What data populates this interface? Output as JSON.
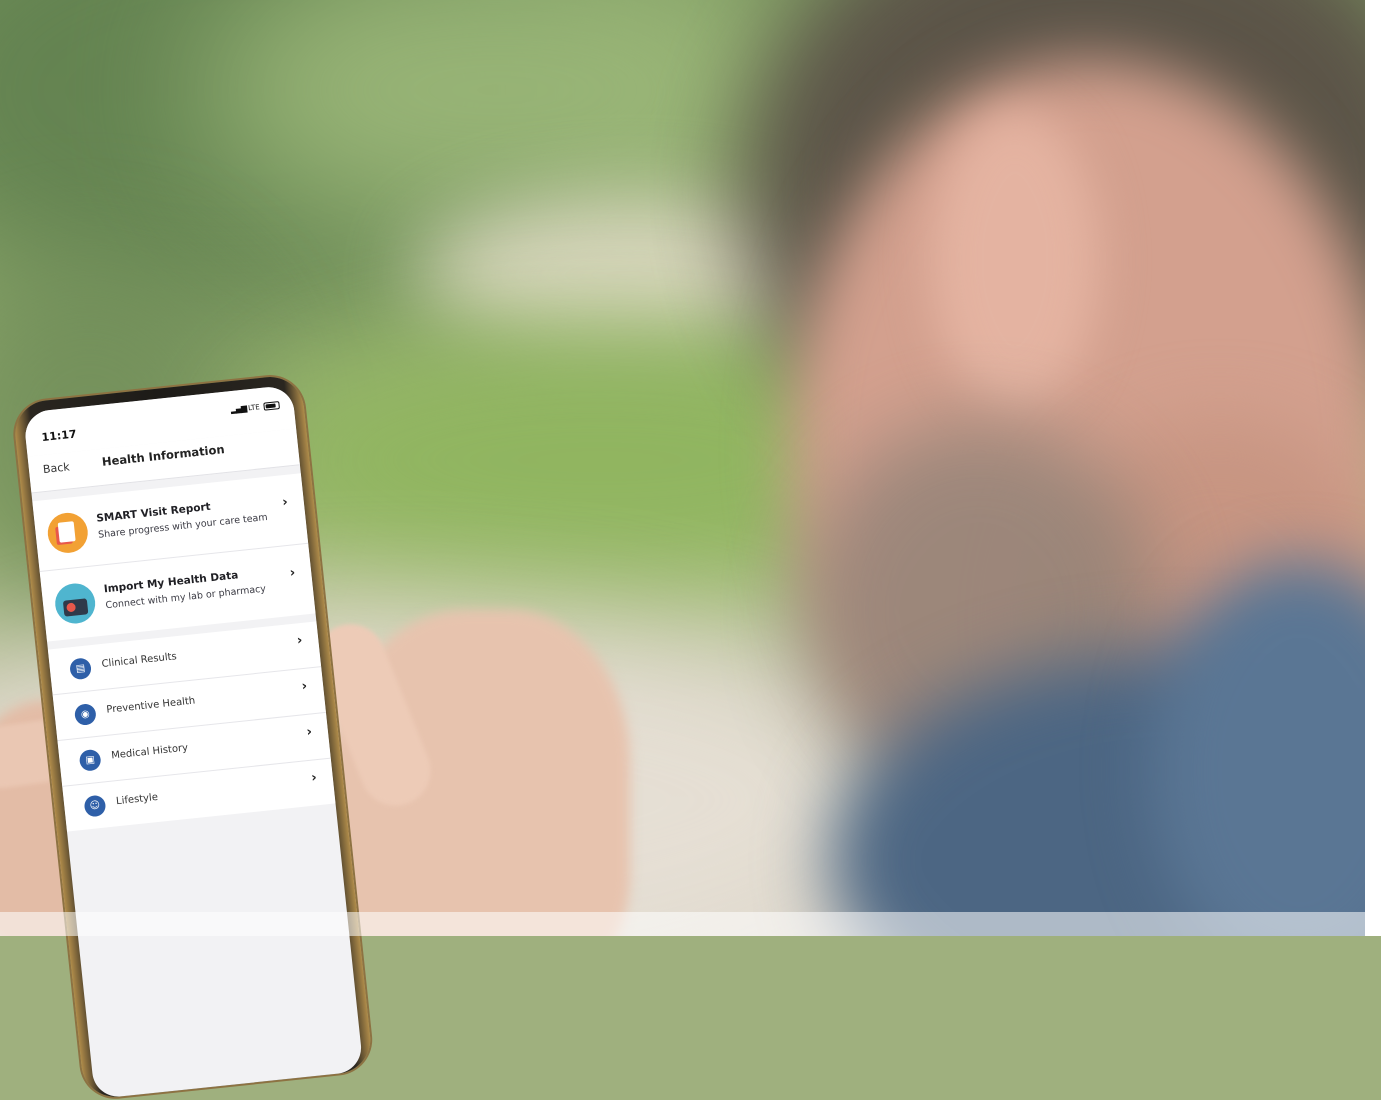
{
  "status_bar": {
    "time": "11:17",
    "network": "LTE"
  },
  "nav": {
    "back_label": "Back",
    "title": "Health Information"
  },
  "featured_items": [
    {
      "title": "SMART Visit Report",
      "subtitle": "Share progress with your care team",
      "icon": "report-icon"
    },
    {
      "title": "Import My Health Data",
      "subtitle": "Connect with my lab or pharmacy",
      "icon": "import-data-icon"
    }
  ],
  "menu_items": [
    {
      "label": "Clinical Results",
      "icon": "clipboard-icon"
    },
    {
      "label": "Preventive Health",
      "icon": "eye-icon"
    },
    {
      "label": "Medical History",
      "icon": "history-icon"
    },
    {
      "label": "Lifestyle",
      "icon": "person-icon"
    }
  ],
  "chevron_glyph": "›",
  "colors": {
    "orange": "#f2a134",
    "teal": "#4fb5cf",
    "blue": "#2e5fa8"
  }
}
